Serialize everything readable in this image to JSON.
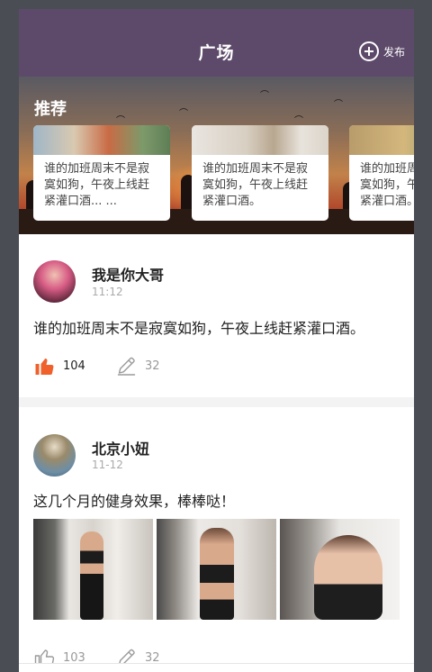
{
  "header": {
    "title": "广场",
    "publish_label": "发布"
  },
  "recommend": {
    "title": "推荐",
    "cards": [
      {
        "text": "谁的加班周末不是寂寞如狗，午夜上线赶紧灌口酒... ..."
      },
      {
        "text": "谁的加班周末不是寂寞如狗，午夜上线赶紧灌口酒。"
      },
      {
        "text": "谁的加班周末不是寂寞如狗，午夜上线赶紧灌口酒。"
      }
    ]
  },
  "posts": [
    {
      "username": "我是你大哥",
      "time": "11:12",
      "content": "谁的加班周末不是寂寞如狗，午夜上线赶紧灌口酒。",
      "likes": "104",
      "comments": "32"
    },
    {
      "username": "北京小妞",
      "time": "11-12",
      "content": "这几个月的健身效果，棒棒哒！",
      "likes": "103",
      "comments": "32"
    }
  ],
  "colors": {
    "header_bg": "#5d4a6b",
    "like_active": "#f0602a",
    "icon_gray": "#9a9a9a"
  },
  "icons": {
    "publish": "plus-circle-icon",
    "like": "thumbs-up-icon",
    "comment": "pencil-icon"
  }
}
